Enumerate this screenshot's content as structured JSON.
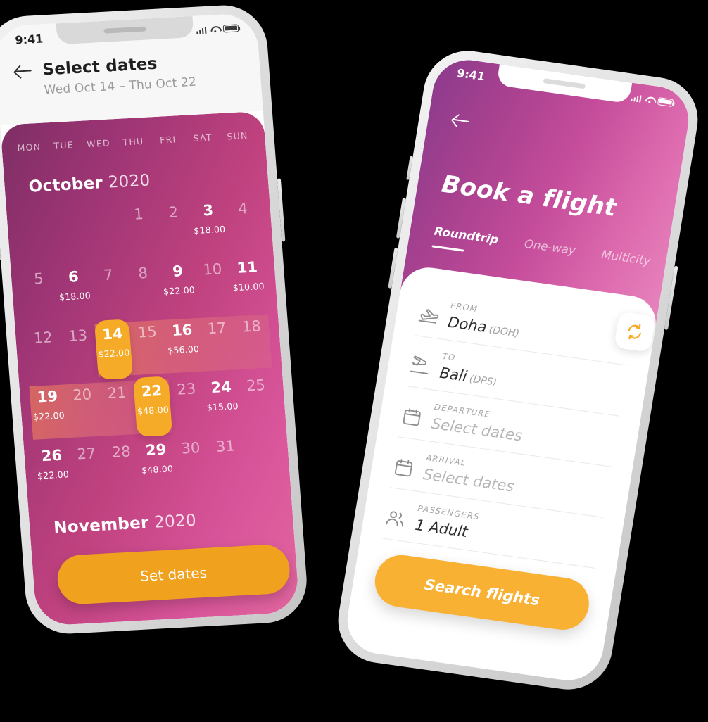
{
  "colors": {
    "accent_orange": "#F0A21E",
    "accent_amber": "#F8B133",
    "selected_day": "#F5AB27",
    "gradient_purple": "#7E2E64",
    "gradient_pink": "#E2669F",
    "hero_purple": "#8C3B8D",
    "hero_pink": "#E784BD",
    "range_band": "#DE6B72"
  },
  "left_phone": {
    "status_bar": {
      "time": "9:41",
      "icons": [
        "signal-bars-icon",
        "wifi-icon",
        "battery-icon"
      ]
    },
    "header": {
      "back_icon": "back-arrow-icon",
      "title": "Select dates",
      "subtitle": "Wed Oct 14 – Thu Oct 22"
    },
    "calendar": {
      "day_headers": [
        "MON",
        "TUE",
        "WED",
        "THU",
        "FRI",
        "SAT",
        "SUN"
      ],
      "month_name": "October",
      "month_year": "2020",
      "next_month_name": "November",
      "next_month_year": "2020",
      "weeks": [
        [
          {
            "day": "",
            "price": ""
          },
          {
            "day": "",
            "price": ""
          },
          {
            "day": "",
            "price": ""
          },
          {
            "day": "1",
            "price": ""
          },
          {
            "day": "2",
            "price": ""
          },
          {
            "day": "3",
            "price": "$18.00"
          },
          {
            "day": "4",
            "price": ""
          }
        ],
        [
          {
            "day": "5",
            "price": ""
          },
          {
            "day": "6",
            "price": "$18.00"
          },
          {
            "day": "7",
            "price": ""
          },
          {
            "day": "8",
            "price": ""
          },
          {
            "day": "9",
            "price": "$22.00"
          },
          {
            "day": "10",
            "price": ""
          },
          {
            "day": "11",
            "price": "$10.00"
          }
        ],
        [
          {
            "day": "12",
            "price": ""
          },
          {
            "day": "13",
            "price": ""
          },
          {
            "day": "14",
            "price": "$22.00",
            "selected": true
          },
          {
            "day": "15",
            "price": ""
          },
          {
            "day": "16",
            "price": "$56.00"
          },
          {
            "day": "17",
            "price": ""
          },
          {
            "day": "18",
            "price": ""
          }
        ],
        [
          {
            "day": "19",
            "price": "$22.00"
          },
          {
            "day": "20",
            "price": ""
          },
          {
            "day": "21",
            "price": ""
          },
          {
            "day": "22",
            "price": "$48.00",
            "selected": true
          },
          {
            "day": "23",
            "price": ""
          },
          {
            "day": "24",
            "price": "$15.00"
          },
          {
            "day": "25",
            "price": ""
          }
        ],
        [
          {
            "day": "26",
            "price": "$22.00"
          },
          {
            "day": "27",
            "price": ""
          },
          {
            "day": "28",
            "price": ""
          },
          {
            "day": "29",
            "price": "$48.00"
          },
          {
            "day": "30",
            "price": ""
          },
          {
            "day": "31",
            "price": ""
          },
          {
            "day": "",
            "price": ""
          }
        ]
      ]
    },
    "set_dates_button": "Set dates"
  },
  "right_phone": {
    "status_bar": {
      "time": "9:41",
      "icons": [
        "signal-bars-icon",
        "wifi-icon",
        "battery-icon"
      ]
    },
    "back_icon": "back-arrow-icon",
    "title": "Book a flight",
    "tabs": [
      {
        "label": "Roundtrip",
        "active": true
      },
      {
        "label": "One-way",
        "active": false
      },
      {
        "label": "Multicity",
        "active": false
      }
    ],
    "fields": [
      {
        "icon": "plane-takeoff-icon",
        "label": "FROM",
        "value": "Doha",
        "code": "(DOH)",
        "is_placeholder": false
      },
      {
        "icon": "plane-landing-icon",
        "label": "TO",
        "value": "Bali",
        "code": "(DPS)",
        "is_placeholder": false
      },
      {
        "icon": "calendar-icon",
        "label": "DEPARTURE",
        "value": "Select dates",
        "code": "",
        "is_placeholder": true
      },
      {
        "icon": "calendar-icon",
        "label": "ARRIVAL",
        "value": "Select dates",
        "code": "",
        "is_placeholder": true
      },
      {
        "icon": "passengers-icon",
        "label": "PASSENGERS",
        "value": "1 Adult",
        "code": "",
        "is_placeholder": false
      }
    ],
    "swap_icon": "swap-arrows-icon",
    "search_button": "Search flights"
  }
}
